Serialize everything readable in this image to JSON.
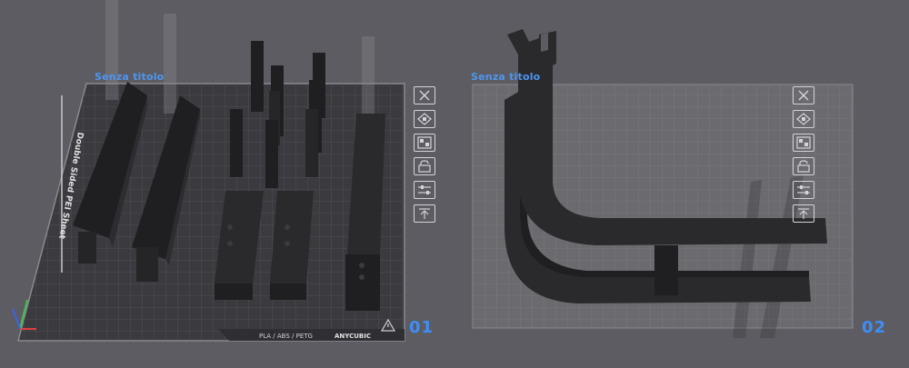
{
  "plates": [
    {
      "id": "01",
      "title": "Senza titolo",
      "number": "01",
      "bed_label": "Double Sided PEI Sheet",
      "filament_text": "PLA / ABS / PETG",
      "brand": "ANYCUBIC"
    },
    {
      "id": "02",
      "title": "Senza titolo",
      "number": "02"
    }
  ],
  "toolbar_icons": [
    "close-icon",
    "arrange-icon",
    "layout-icon",
    "lock-icon",
    "settings-sliders-icon",
    "upload-icon"
  ],
  "colors": {
    "background": "#5c5c62",
    "plate_dark": "#3a3a3f",
    "plate_light": "#6a6a6f",
    "accent": "#3e8ef7",
    "model": "#2a2a2d"
  }
}
